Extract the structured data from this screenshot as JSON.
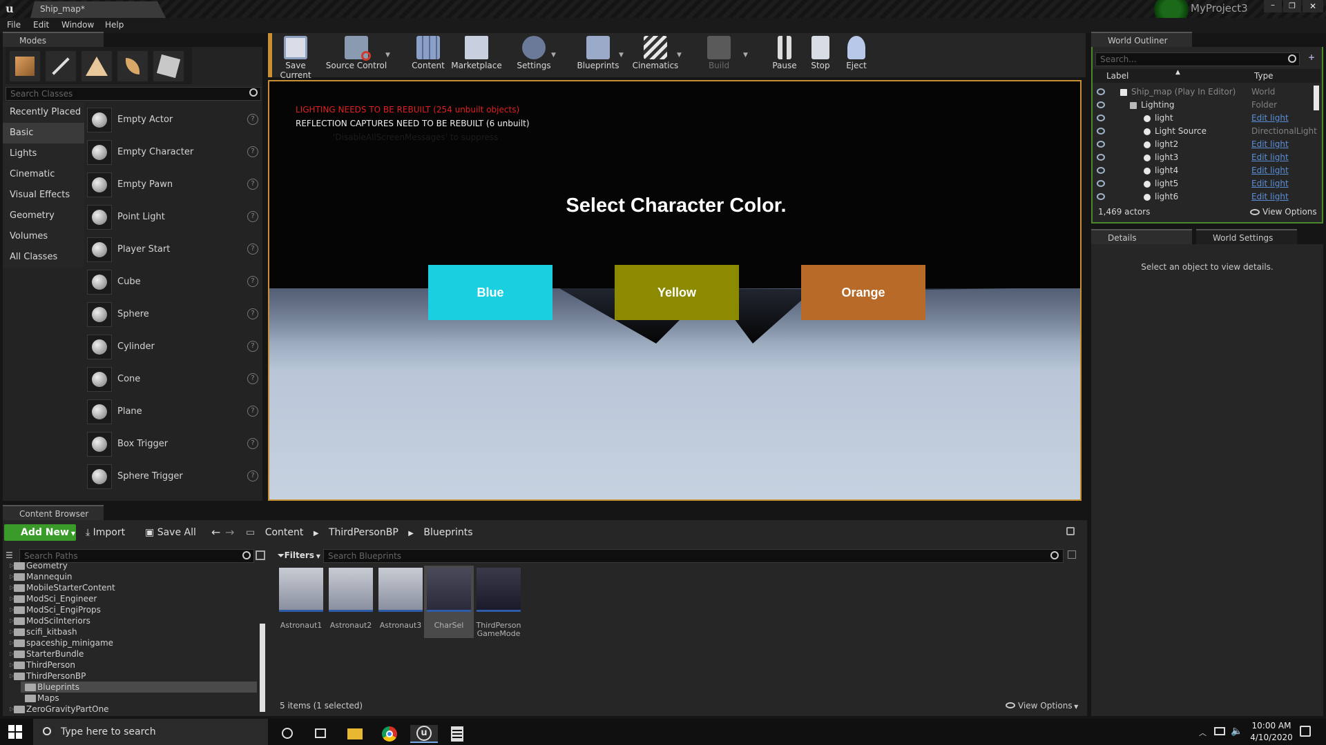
{
  "window": {
    "tab_title": "Ship_map*",
    "project": "MyProject3"
  },
  "menu": [
    "File",
    "Edit",
    "Window",
    "Help"
  ],
  "modes": {
    "tab_label": "Modes",
    "search_placeholder": "Search Classes",
    "categories": [
      "Recently Placed",
      "Basic",
      "Lights",
      "Cinematic",
      "Visual Effects",
      "Geometry",
      "Volumes",
      "All Classes"
    ],
    "selected_category": "Basic",
    "items": [
      "Empty Actor",
      "Empty Character",
      "Empty Pawn",
      "Point Light",
      "Player Start",
      "Cube",
      "Sphere",
      "Cylinder",
      "Cone",
      "Plane",
      "Box Trigger",
      "Sphere Trigger"
    ],
    "help_glyph": "?"
  },
  "toolbar": {
    "save_current": "Save Current",
    "source_control": "Source Control",
    "content": "Content",
    "marketplace": "Marketplace",
    "settings": "Settings",
    "blueprints": "Blueprints",
    "cinematics": "Cinematics",
    "build": "Build",
    "pause": "Pause",
    "stop": "Stop",
    "eject": "Eject"
  },
  "viewport": {
    "warning1": "LIGHTING NEEDS TO BE REBUILT (254 unbuilt objects)",
    "warning2": "REFLECTION CAPTURES NEED TO BE REBUILT (6 unbuilt)",
    "faded": "'DisableAllScreenMessages' to suppress",
    "heading": "Select Character Color.",
    "buttons": [
      {
        "label": "Blue",
        "color": "#19cfe0"
      },
      {
        "label": "Yellow",
        "color": "#8c8a00"
      },
      {
        "label": "Orange",
        "color": "#b86a28"
      }
    ]
  },
  "outliner": {
    "tab_label": "World Outliner",
    "search_placeholder": "Search...",
    "col_label": "Label",
    "col_type": "Type",
    "rows": [
      {
        "name": "Ship_map (Play In Editor)",
        "type": "World",
        "link": false
      },
      {
        "name": "Lighting",
        "type": "Folder",
        "link": false
      },
      {
        "name": "light",
        "type": "Edit light",
        "link": true
      },
      {
        "name": "Light Source",
        "type": "DirectionalLight",
        "link": false
      },
      {
        "name": "light2",
        "type": "Edit light",
        "link": true
      },
      {
        "name": "light3",
        "type": "Edit light",
        "link": true
      },
      {
        "name": "light4",
        "type": "Edit light",
        "link": true
      },
      {
        "name": "light5",
        "type": "Edit light",
        "link": true
      },
      {
        "name": "light6",
        "type": "Edit light",
        "link": true
      }
    ],
    "actor_count": "1,469 actors",
    "view_options": "View Options"
  },
  "details": {
    "tab1": "Details",
    "tab2": "World Settings",
    "empty_msg": "Select an object to view details."
  },
  "content_browser": {
    "tab_label": "Content Browser",
    "add_new": "Add New",
    "import": "Import",
    "save_all": "Save All",
    "breadcrumb": [
      "Content",
      "ThirdPersonBP",
      "Blueprints"
    ],
    "search_paths_placeholder": "Search Paths",
    "filters": "Filters",
    "search_placeholder": "Search Blueprints",
    "tree": [
      {
        "name": "Geometry",
        "indent": 0,
        "selected": false
      },
      {
        "name": "Mannequin",
        "indent": 0,
        "selected": false
      },
      {
        "name": "MobileStarterContent",
        "indent": 0,
        "selected": false
      },
      {
        "name": "ModSci_Engineer",
        "indent": 0,
        "selected": false
      },
      {
        "name": "ModSci_EngiProps",
        "indent": 0,
        "selected": false
      },
      {
        "name": "ModSciInteriors",
        "indent": 0,
        "selected": false
      },
      {
        "name": "scifi_kitbash",
        "indent": 0,
        "selected": false
      },
      {
        "name": "spaceship_minigame",
        "indent": 0,
        "selected": false
      },
      {
        "name": "StarterBundle",
        "indent": 0,
        "selected": false
      },
      {
        "name": "ThirdPerson",
        "indent": 0,
        "selected": false
      },
      {
        "name": "ThirdPersonBP",
        "indent": 0,
        "selected": false
      },
      {
        "name": "Blueprints",
        "indent": 1,
        "selected": true
      },
      {
        "name": "Maps",
        "indent": 1,
        "selected": false
      },
      {
        "name": "ZeroGravityPartOne",
        "indent": 0,
        "selected": false
      }
    ],
    "assets": [
      {
        "name": "Astronaut1",
        "name2": ""
      },
      {
        "name": "Astronaut2",
        "name2": ""
      },
      {
        "name": "Astronaut3",
        "name2": ""
      },
      {
        "name": "CharSel",
        "name2": ""
      },
      {
        "name": "ThirdPerson",
        "name2": "GameMode"
      }
    ],
    "status": "5 items (1 selected)",
    "view_options": "View Options"
  },
  "taskbar": {
    "search_placeholder": "Type here to search",
    "time": "10:00 AM",
    "date": "4/10/2020"
  }
}
